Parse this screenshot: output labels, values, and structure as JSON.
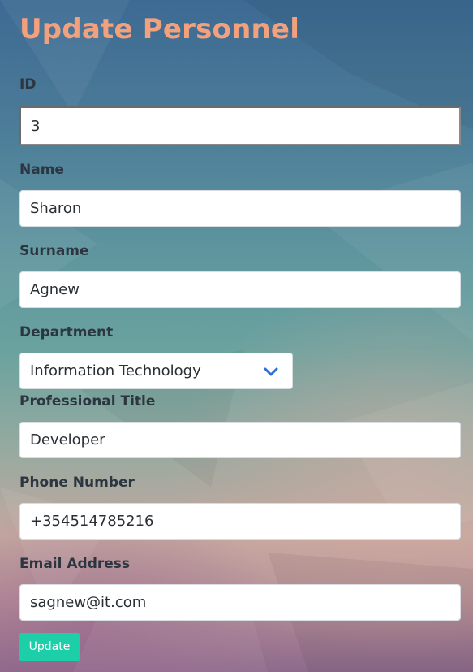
{
  "page_title": "Update Personnel",
  "form": {
    "id": {
      "label": "ID",
      "value": "3"
    },
    "name": {
      "label": "Name",
      "value": "Sharon"
    },
    "surname": {
      "label": "Surname",
      "value": "Agnew"
    },
    "department": {
      "label": "Department",
      "selected": "Information Technology"
    },
    "title": {
      "label": "Professional Title",
      "value": "Developer"
    },
    "phone": {
      "label": "Phone Number",
      "value": "+354514785216"
    },
    "email": {
      "label": "Email Address",
      "value": "sagnew@it.com"
    }
  },
  "actions": {
    "update_label": "Update"
  },
  "colors": {
    "title": "#f3a07d",
    "button": "#1ccfa8",
    "chevron": "#2f6fd6"
  },
  "icons": {
    "department_dropdown": "chevron-down-icon"
  }
}
